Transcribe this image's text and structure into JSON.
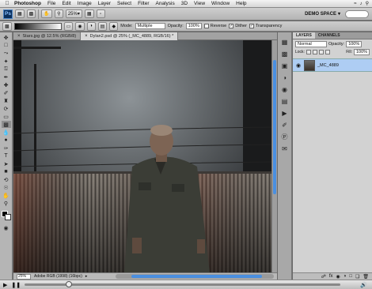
{
  "menubar": {
    "apple": "",
    "items": [
      "Photoshop",
      "File",
      "Edit",
      "Image",
      "Layer",
      "Select",
      "Filter",
      "Analysis",
      "3D",
      "View",
      "Window",
      "Help"
    ]
  },
  "appbar": {
    "logo": "Ps",
    "zoom": "25%",
    "workspace": "DEMO SPACE"
  },
  "options": {
    "mode_label": "Mode:",
    "mode_value": "Multiple",
    "opacity_label": "Opacity:",
    "opacity_value": "100%",
    "reverse_label": "Reverse",
    "dither_label": "Dither",
    "transparency_label": "Transparency"
  },
  "documents": {
    "tabs": [
      {
        "label": "Stars.jpg @ 12.5% (RGB/8)"
      },
      {
        "label": "Dylan2.psd @ 25% (_MC_4889, RGB/16) *"
      }
    ]
  },
  "statusbar": {
    "zoom": "25%",
    "info": "Adobe RGB (1998) (16bpc)"
  },
  "layers": {
    "tabs": [
      "LAYERS",
      "CHANNELS"
    ],
    "blend_mode": "Normal",
    "opacity_label": "Opacity:",
    "opacity_value": "100%",
    "lock_label": "Lock:",
    "fill_label": "Fill:",
    "fill_value": "100%",
    "layer_name": "_MC_4889"
  },
  "colors": {
    "accent": "#4a8fe0",
    "selected_layer": "#aecdf3"
  }
}
